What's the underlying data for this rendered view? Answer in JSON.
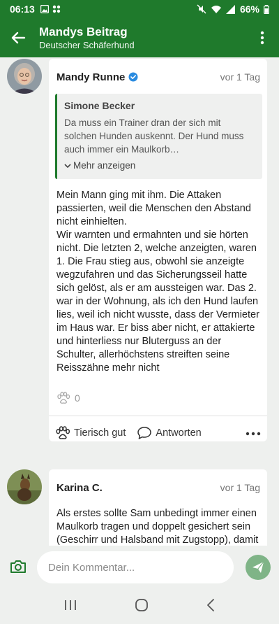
{
  "status": {
    "time": "06:13",
    "battery": "66%"
  },
  "header": {
    "title": "Mandys Beitrag",
    "subtitle": "Deutscher Schäferhund"
  },
  "post": {
    "author": "Mandy Runne",
    "time": "vor 1 Tag",
    "quote": {
      "author": "Simone Becker",
      "text": "Da muss ein Trainer dran der sich mit solchen Hunden auskennt. Der Hund muss auch immer ein Maulkorb…",
      "more_label": "Mehr anzeigen"
    },
    "text": "Mein Mann ging mit ihm. Die Attaken passierten, weil die Menschen den Abstand nicht einhielten.\nWir warnten und ermahnten und sie hörten nicht. Die letzten 2, welche anzeigten, waren\n1. Die Frau stieg aus, obwohl sie anzeigte wegzufahren und das Sicherungsseil hatte sich gelöst, als er am aussteigen war. Das 2. war in der Wohnung, als ich den Hund laufen lies, weil ich nicht wusste, dass der Vermieter im Haus war. Er biss aber nicht, er attakierte und hinterliess nur Bluterguss an der Schulter, allerhöchstens streiften seine Reisszähne mehr nicht",
    "like_count": "0",
    "like_label": "Tierisch gut",
    "reply_label": "Antworten"
  },
  "reply": {
    "author": "Karina C.",
    "time": "vor 1 Tag",
    "text": "Als erstes sollte Sam unbedingt immer einen Maulkorb tragen und doppelt gesichert sein (Geschirr und Halsband mit Zugstopp), damit ihr ihn in jedem Fall"
  },
  "composer": {
    "placeholder": "Dein Kommentar..."
  },
  "colors": {
    "primary": "#1f7a2c",
    "send_button": "#7fb487",
    "background": "#eef0ee"
  },
  "icons": [
    "back-arrow-icon",
    "more-vert-icon",
    "verified-badge-icon",
    "chevron-down-icon",
    "paw-icon",
    "comment-icon",
    "more-horiz-icon",
    "camera-icon",
    "send-icon",
    "nav-recents-icon",
    "nav-home-icon",
    "nav-back-icon"
  ]
}
